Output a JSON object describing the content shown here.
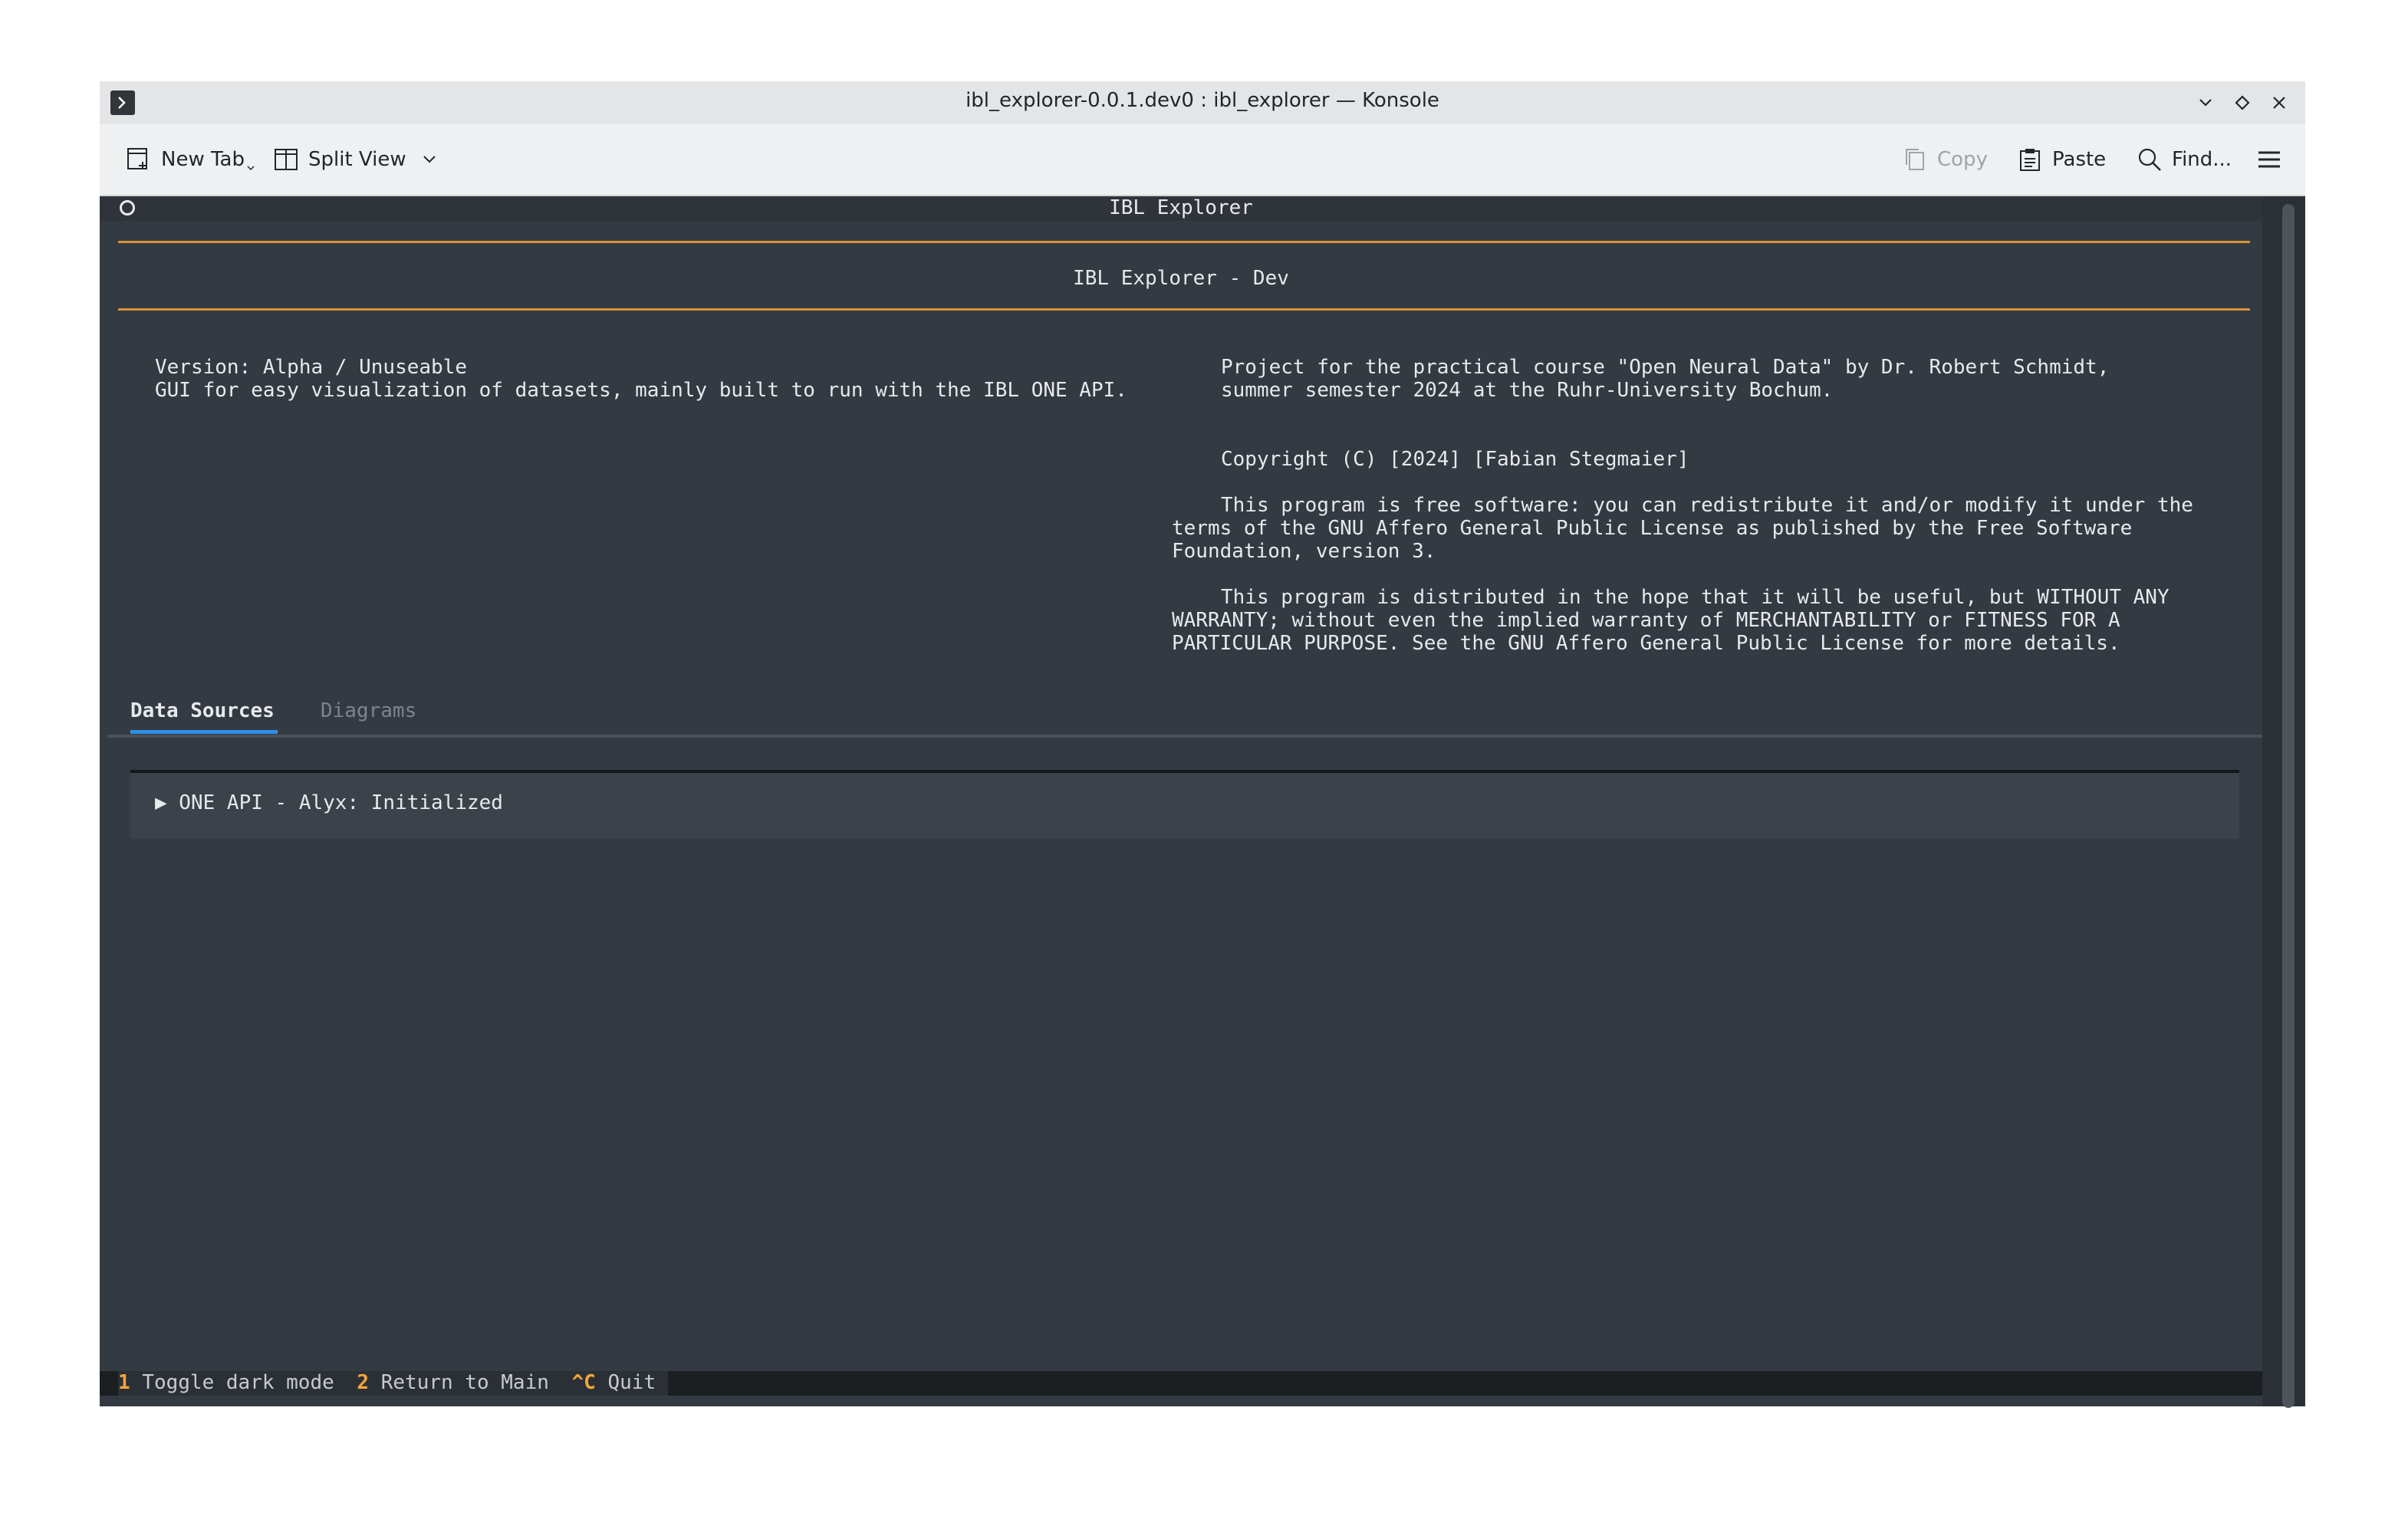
{
  "window": {
    "title": "ibl_explorer-0.0.1.dev0 : ibl_explorer — Konsole",
    "controls": [
      "minimize-icon",
      "maximize-icon",
      "close-icon"
    ]
  },
  "toolbar": {
    "new_tab": "New Tab",
    "split_view": "Split View",
    "copy": "Copy",
    "paste": "Paste",
    "find": "Find..."
  },
  "app": {
    "header_title": "IBL Explorer",
    "subtitle": "IBL Explorer - Dev",
    "version": "Version: Alpha / Unuseable",
    "description": "GUI for easy visualization of datasets, mainly built to run with the IBL ONE API.",
    "project_line1": "Project for the practical course \"Open Neural Data\" by Dr. Robert Schmidt,",
    "project_line2": "summer semester 2024 at the Ruhr-University Bochum.",
    "copyright": "Copyright (C) [2024] [Fabian Stegmaier]",
    "license1_line1": "This program is free software: you can redistribute it and/or modify it under the",
    "license1_line2": "terms of the GNU Affero General Public License as published by the Free Software",
    "license1_line3": "Foundation, version 3.",
    "license2_line1": "This program is distributed in the hope that it will be useful, but WITHOUT ANY",
    "license2_line2": "WARRANTY; without even the implied warranty of MERCHANTABILITY or FITNESS FOR A",
    "license2_line3": "PARTICULAR PURPOSE. See the GNU Affero General Public License for more details."
  },
  "tabs": [
    {
      "label": "Data Sources",
      "active": true
    },
    {
      "label": "Diagrams",
      "active": false
    }
  ],
  "panel": {
    "collapsible_label": "▶ ONE API - Alyx: Initialized"
  },
  "footer": {
    "bindings": [
      {
        "key": "1",
        "desc": " Toggle dark mode "
      },
      {
        "key": "2",
        "desc": " Return to Main "
      },
      {
        "key": "^C",
        "desc": " Quit "
      }
    ]
  },
  "colors": {
    "accent_orange": "#d89234",
    "tab_underline": "#2f8fe6",
    "footer_key": "#f6a43a",
    "terminal_bg": "#333a42"
  }
}
